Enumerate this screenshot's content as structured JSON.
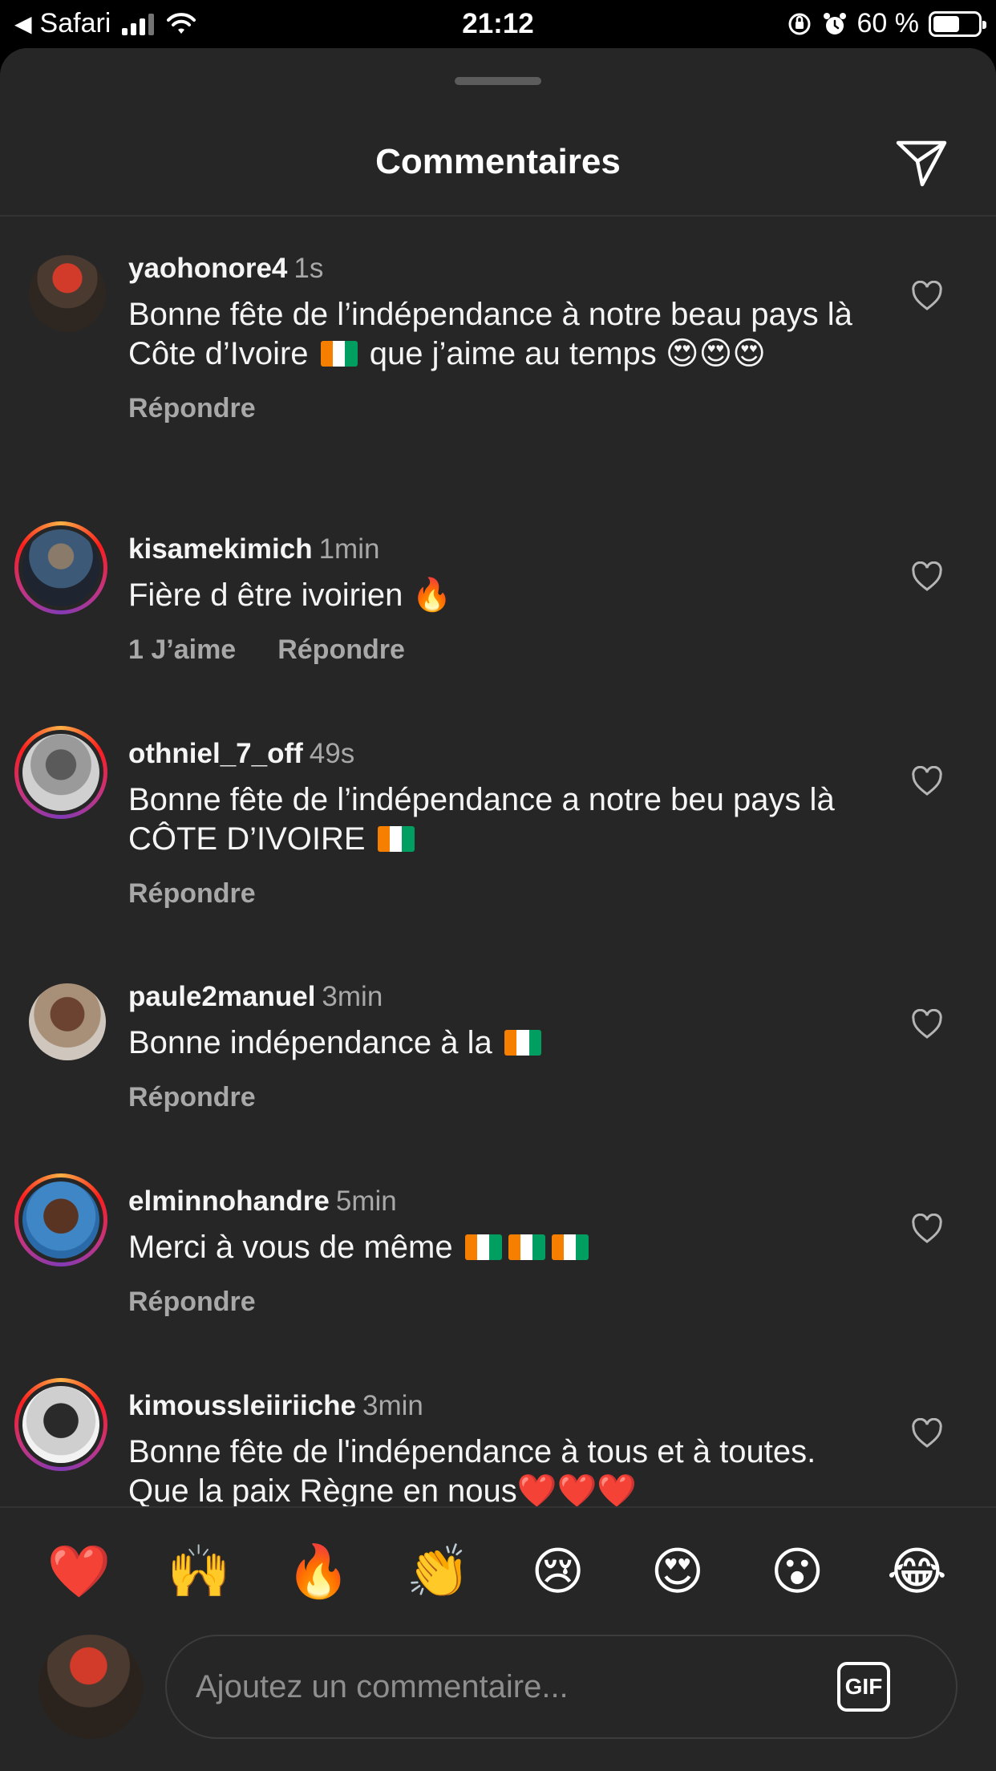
{
  "status_bar": {
    "back_app": "Safari",
    "time": "21:12",
    "battery": "60 %"
  },
  "header": {
    "title": "Commentaires"
  },
  "comments": [
    {
      "username": "yaohonore4",
      "time": "1s",
      "text": "Bonne fête de l’indépendance à notre beau pays là Côte d’Ivoire 🇨🇮 que j’aime au temps 😍😍😍",
      "likes": "",
      "reply": "Répondre"
    },
    {
      "username": "kisamekimich",
      "time": "1min",
      "text": "Fière d être ivoirien 🔥",
      "likes": "1 J’aime",
      "reply": "Répondre"
    },
    {
      "username": "othniel_7_off",
      "time": "49s",
      "text": "Bonne fête de l’indépendance a notre beu pays là CÔTE D’IVOIRE 🇨🇮",
      "likes": "",
      "reply": "Répondre"
    },
    {
      "username": "paule2manuel",
      "time": "3min",
      "text": "Bonne indépendance à la 🇨🇮",
      "likes": "",
      "reply": "Répondre"
    },
    {
      "username": "elminnohandre",
      "time": "5min",
      "text": "Merci à vous de même 🇨🇮🇨🇮🇨🇮",
      "likes": "",
      "reply": "Répondre"
    },
    {
      "username": "kimoussleiiriiche",
      "time": "3min",
      "text": "Bonne fête de l'indépendance à tous et à toutes. Que la paix Règne en nous❤️❤️❤️",
      "likes": "",
      "reply": ""
    }
  ],
  "reactions": [
    "❤️",
    "🙌",
    "🔥",
    "👏",
    "😢",
    "😍",
    "😮",
    "😂"
  ],
  "composer": {
    "placeholder": "Ajoutez un commentaire...",
    "gif_label": "GIF"
  },
  "colors": {
    "sheet_bg": "#262626",
    "secondary_text": "#a8a8a8",
    "flag_orange": "#f77f00",
    "flag_green": "#009e60"
  }
}
